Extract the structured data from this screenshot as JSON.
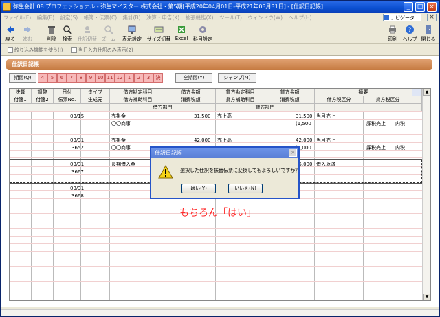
{
  "window": {
    "title": "弥生会計 08 プロフェッショナル - 弥生マイスター 株式会社・第5期[平成20年04月01日-平成21年03月31日] - [仕訳日記帳]"
  },
  "menu": {
    "items": [
      "ファイル(F)",
      "編集(E)",
      "設定(S)",
      "帳簿・伝票(C)",
      "集計(B)",
      "決算・申告(K)",
      "拡張機能(X)",
      "ツール(T)",
      "ウィンドウ(W)",
      "ヘルプ(H)"
    ],
    "navigator": "ナビゲータ"
  },
  "toolbar": {
    "back": "戻る",
    "forward": "進む",
    "delete": "削除",
    "search": "検索",
    "batch": "仕訳切替",
    "zoom": "ズーム",
    "display": "表示設定",
    "size": "サイズ切替",
    "excel": "Excel",
    "account": "科目設定",
    "print": "印刷",
    "help": "ヘルプ",
    "close": "閉じる"
  },
  "filter": {
    "narrow": "絞り込み機能を使う(I)",
    "today": "当日入力仕訳のみ表示(2)"
  },
  "header": {
    "title": "仕訳日記帳"
  },
  "period": {
    "label": "期間(Q)",
    "months": [
      "4",
      "5",
      "6",
      "7",
      "8",
      "9",
      "10",
      "11",
      "12",
      "1",
      "2",
      "3",
      "決"
    ],
    "all": "全期間(Y)",
    "jump": "ジャンプ(M)"
  },
  "grid": {
    "headers_row1": [
      "決算",
      "調整",
      "日付",
      "タイプ",
      "借方勘定科目",
      "借方金額",
      "貸方勘定科目",
      "貸方金額",
      "摘要"
    ],
    "headers_row2": [
      "付箋1",
      "付箋2",
      "伝票No.",
      "生成元",
      "借方補助科目",
      "消費税額",
      "貸方補助科目",
      "消費税額",
      "借方税区分",
      "貸方税区分"
    ],
    "headers_row3": [
      "借方部門",
      "貸方部門"
    ],
    "rows": [
      {
        "date": "03/15",
        "no": "",
        "debit_account": "売掛金",
        "debit_sub": "〇〇商事",
        "debit_amount": "31,500",
        "credit_account": "売上高",
        "credit_amount": "31,500",
        "credit_tax": "(1,500",
        "memo": "当月売上",
        "tax_category": "課税売上",
        "tax_mode": "内税"
      },
      {
        "date": "03/31",
        "no": "3652",
        "debit_account": "売掛金",
        "debit_sub": "〇〇商事",
        "debit_amount": "42,000",
        "credit_account": "売上高",
        "credit_amount": "42,000",
        "credit_tax": "(2,000",
        "memo": "当月売上",
        "tax_category": "課税売上",
        "tax_mode": "内税"
      },
      {
        "date": "03/31",
        "no": "3667",
        "debit_account": "長期借入金",
        "debit_sub": "",
        "debit_amount": "",
        "credit_account": "",
        "credit_amount": "05,000",
        "credit_tax": "",
        "memo": "借入返済",
        "tax_category": "",
        "tax_mode": ""
      },
      {
        "date": "03/31",
        "no": "3668",
        "debit_account": "",
        "debit_sub": "",
        "debit_amount": "",
        "credit_account": "",
        "credit_amount": "",
        "credit_tax": "",
        "memo": "",
        "tax_category": "",
        "tax_mode": ""
      }
    ]
  },
  "dialog": {
    "title": "仕訳日記帳",
    "message": "選択した仕訳を振替伝票に変換してもよろしいですか？",
    "yes": "はい(Y)",
    "no": "いいえ(N)"
  },
  "annotation": {
    "text": "もちろん「はい」",
    "color": "#ff2a2a"
  }
}
